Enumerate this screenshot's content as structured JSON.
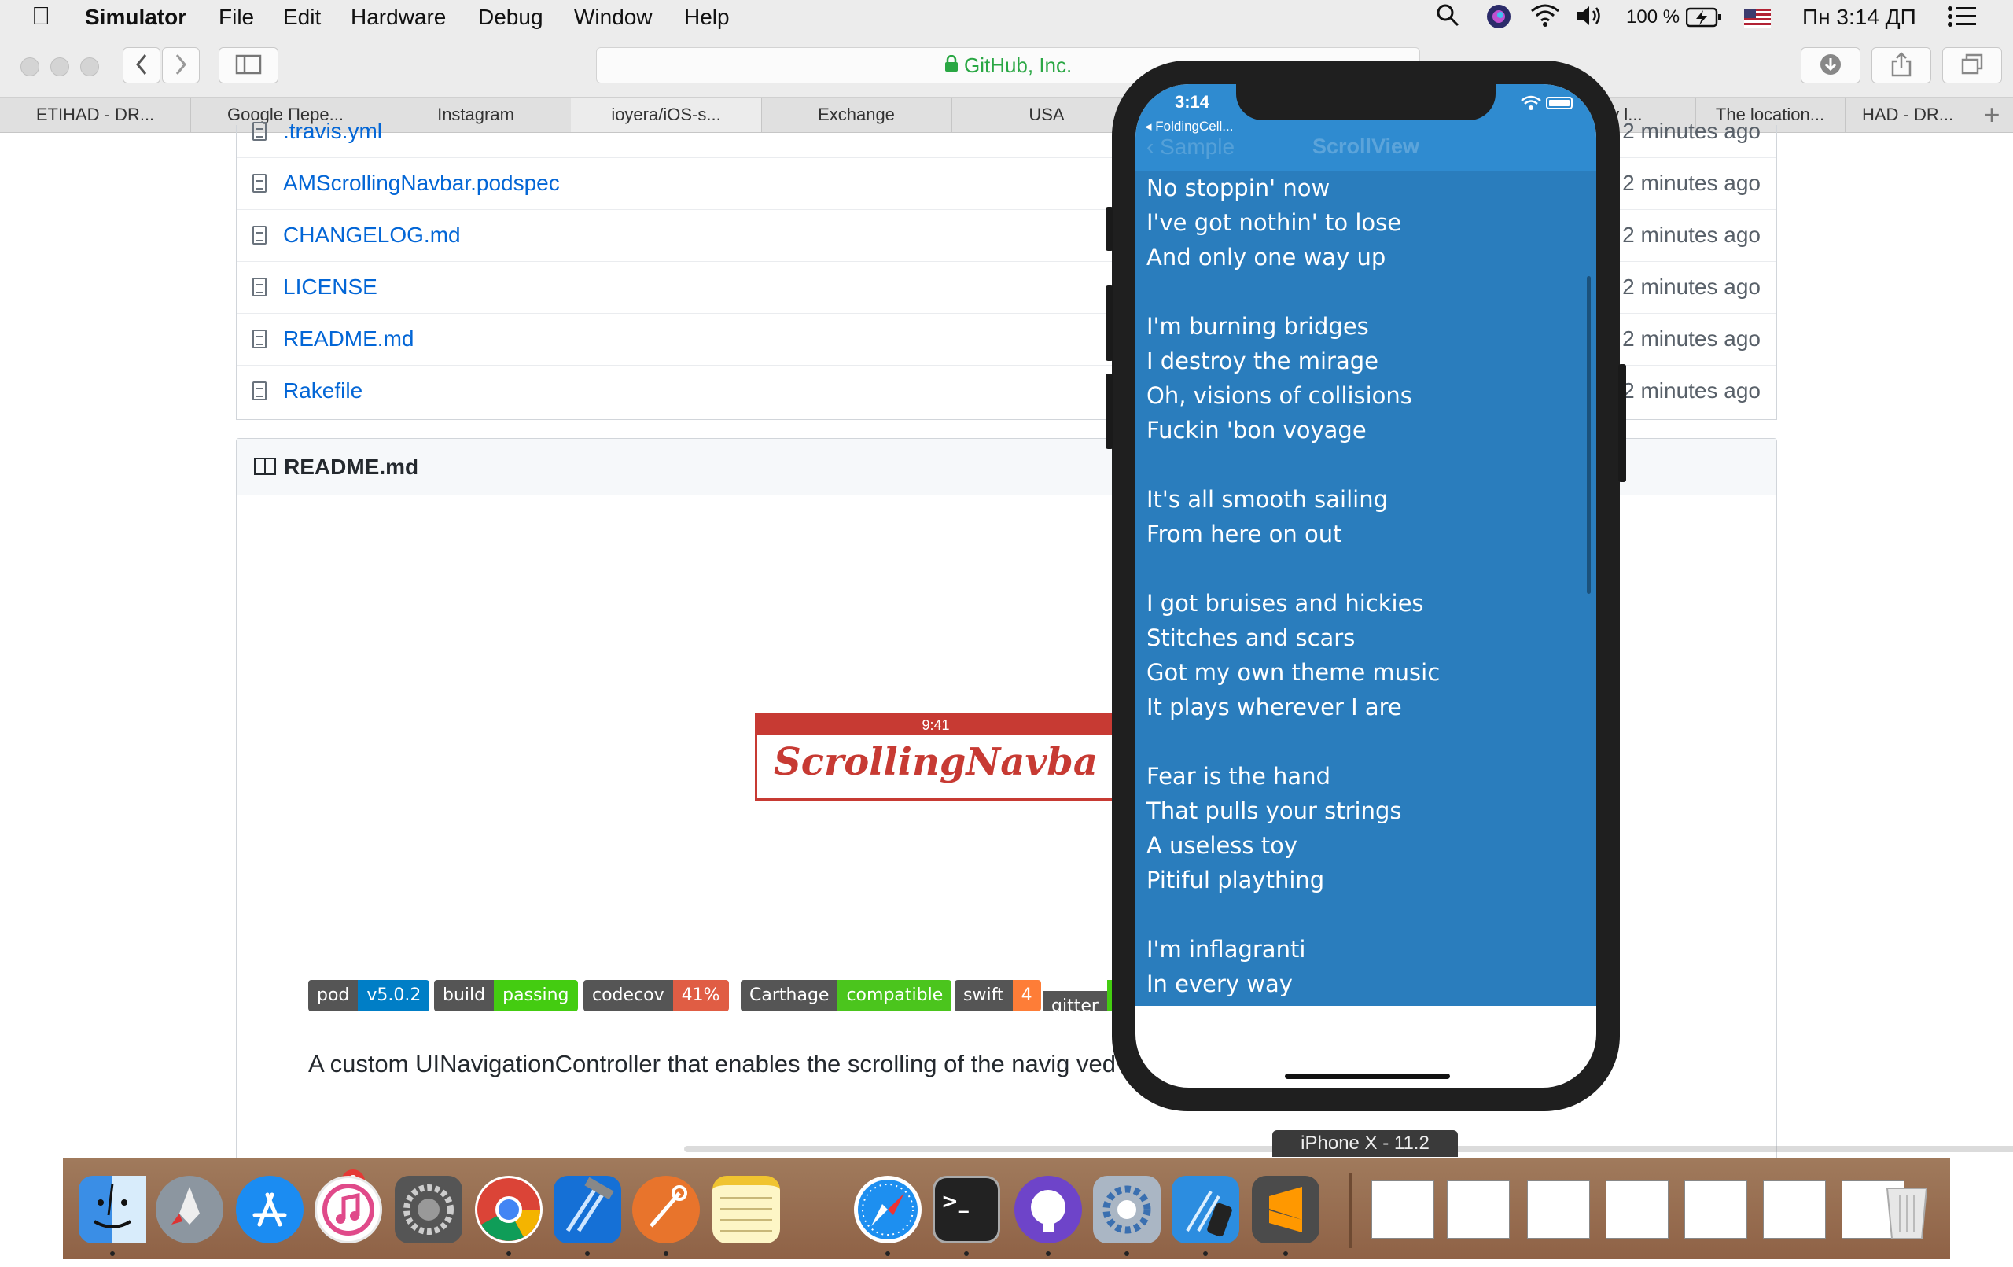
{
  "menubar": {
    "app_name": "Simulator",
    "menus": [
      "File",
      "Edit",
      "Hardware",
      "Debug",
      "Window",
      "Help"
    ],
    "battery_text": "100 %",
    "clock": "Пн 3:14 ДП"
  },
  "browser": {
    "address": "GitHub, Inc.",
    "tabs": [
      "ETIHAD - DR...",
      "Google Пере...",
      "Instagram",
      "ioyera/iOS-s...",
      "Exchange",
      "USA",
      "nv l...",
      "The location...",
      "HAD - DR..."
    ]
  },
  "files": [
    {
      "name": ".travis.yml",
      "age": "2 minutes ago"
    },
    {
      "name": "AMScrollingNavbar.podspec",
      "age": "2 minutes ago"
    },
    {
      "name": "CHANGELOG.md",
      "age": "2 minutes ago"
    },
    {
      "name": "LICENSE",
      "age": "2 minutes ago"
    },
    {
      "name": "README.md",
      "age": "2 minutes ago"
    },
    {
      "name": "Rakefile",
      "age": "2 minutes ago"
    }
  ],
  "readme": {
    "title": "README.md",
    "logo_time": "9:41",
    "logo_text": "ScrollingNavba",
    "badges": [
      {
        "label": "pod",
        "value": "v5.0.2",
        "color": "#007ec6"
      },
      {
        "label": "build",
        "value": "passing",
        "color": "#4c1"
      },
      {
        "label": "codecov",
        "value": "41%",
        "color": "#e05d44"
      },
      {
        "label": "Carthage",
        "value": "compatible",
        "color": "#4bc51d"
      },
      {
        "label": "swift",
        "value": "4",
        "color": "#fe7d37"
      },
      {
        "label": "gitter",
        "value": "",
        "color": "#4c1"
      }
    ],
    "description": "A custom UINavigationController that enables the scrolling of the navig                                                                              ved content view"
  },
  "simulator": {
    "time": "3:14",
    "back_app": "◂ FoldingCell...",
    "back_ghost": "Sample",
    "title": "ScrollView",
    "lyrics": "No stoppin' now\nI've got nothin' to lose\nAnd only one way up\n\nI'm burning bridges\nI destroy the mirage\nOh, visions of collisions\nFuckin 'bon voyage\n\nIt's all smooth sailing\nFrom here on out\n\nI got bruises and hickies\nStitches and scars\nGot my own theme music\nIt plays wherever I are\n\nFear is the hand\nThat pulls your strings\nA useless toy\nPitiful plaything\n\nI'm inflagranti\nIn every way",
    "device_label": "iPhone X - 11.2"
  },
  "dock": {
    "appstore_badge": "9",
    "apps": [
      "finder",
      "launchpad",
      "app-store",
      "itunes",
      "system-preferences",
      "chrome",
      "xcode",
      "instruments",
      "notes",
      "safari",
      "terminal",
      "github-desktop",
      "system-prefs-alt",
      "simulator",
      "sublime-text"
    ]
  },
  "colors": {
    "navbar": "#2f8bd0",
    "lyrics_bg": "#2a7dbd",
    "link": "#0366d6",
    "logo_red": "#c73a33"
  }
}
